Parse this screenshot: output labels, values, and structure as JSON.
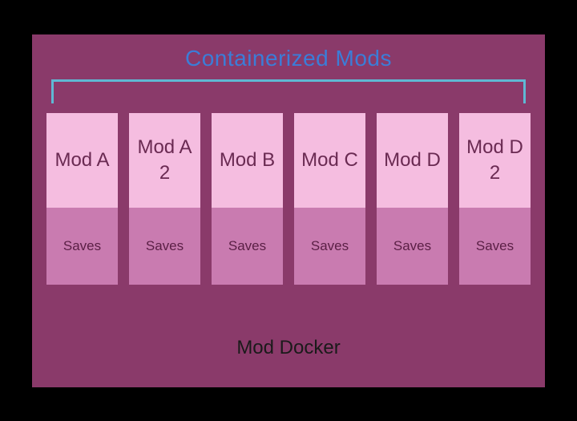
{
  "title": "Containerized Mods",
  "mods": [
    {
      "name": "Mod A",
      "saves": "Saves"
    },
    {
      "name": "Mod A 2",
      "saves": "Saves"
    },
    {
      "name": "Mod B",
      "saves": "Saves"
    },
    {
      "name": "Mod C",
      "saves": "Saves"
    },
    {
      "name": "Mod D",
      "saves": "Saves"
    },
    {
      "name": "Mod D 2",
      "saves": "Saves"
    }
  ],
  "footer": "Mod Docker"
}
